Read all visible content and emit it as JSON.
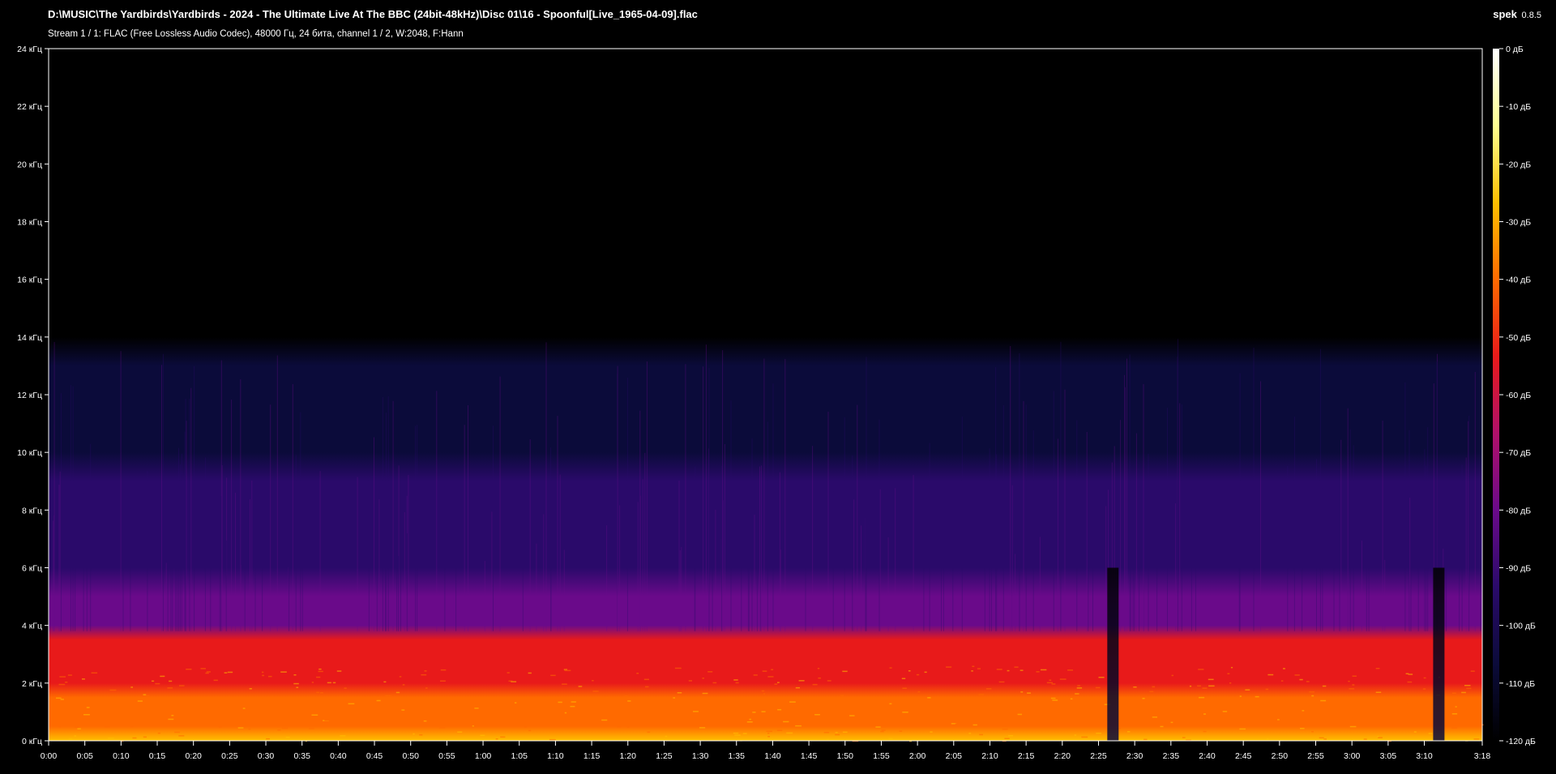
{
  "window": {
    "title": "D:\\MUSIC\\The Yardbirds\\Yardbirds - 2024 - The Ultimate Live At The BBC (24bit-48kHz)\\Disc 01\\16 - Spoonful[Live_1965-04-09].flac",
    "subtitle": "Stream 1 / 1: FLAC (Free Lossless Audio Codec), 48000 Гц, 24 бита, channel 1 / 2, W:2048, F:Hann",
    "app_name": "spek",
    "app_version": "0.8.5"
  },
  "colors": {
    "background": "#000000",
    "axis": "#ffffff",
    "palette": [
      "#000000",
      "#0b0b3a",
      "#2a0a6a",
      "#6a0a8a",
      "#b0106a",
      "#e81a1a",
      "#ff6a00",
      "#ffc000",
      "#ffff90",
      "#ffffff"
    ]
  },
  "chart_data": {
    "type": "heatmap",
    "title": "",
    "xlabel": "",
    "ylabel": "",
    "x_unit": "time (m:ss)",
    "y_unit": "кГц",
    "xlim": [
      0,
      198
    ],
    "ylim": [
      0,
      24
    ],
    "x_ticks": [
      "0:00",
      "0:05",
      "0:10",
      "0:15",
      "0:20",
      "0:25",
      "0:30",
      "0:35",
      "0:40",
      "0:45",
      "0:50",
      "0:55",
      "1:00",
      "1:05",
      "1:10",
      "1:15",
      "1:20",
      "1:25",
      "1:30",
      "1:35",
      "1:40",
      "1:45",
      "1:50",
      "1:55",
      "2:00",
      "2:05",
      "2:10",
      "2:15",
      "2:20",
      "2:25",
      "2:30",
      "2:35",
      "2:40",
      "2:45",
      "2:50",
      "2:55",
      "3:00",
      "3:05",
      "3:10",
      "3:18"
    ],
    "y_ticks": [
      "0 кГц",
      "2 кГц",
      "4 кГц",
      "6 кГц",
      "8 кГц",
      "10 кГц",
      "12 кГц",
      "14 кГц",
      "16 кГц",
      "18 кГц",
      "20 кГц",
      "22 кГц",
      "24 кГц"
    ],
    "colorbar": {
      "range_db": [
        -120,
        0
      ],
      "ticks": [
        "0 дБ",
        "-10 дБ",
        "-20 дБ",
        "-30 дБ",
        "-40 дБ",
        "-50 дБ",
        "-60 дБ",
        "-70 дБ",
        "-80 дБ",
        "-90 дБ",
        "-100 дБ",
        "-110 дБ",
        "-120 дБ"
      ]
    },
    "energy_profile": {
      "freq_khz": [
        0,
        0.5,
        1,
        1.5,
        2,
        2.5,
        3,
        3.5,
        4,
        5,
        6,
        7,
        8,
        9,
        10,
        11,
        12,
        13,
        14,
        15
      ],
      "level_db": [
        -30,
        -35,
        -40,
        -45,
        -48,
        -52,
        -55,
        -60,
        -80,
        -85,
        -88,
        -92,
        -95,
        -98,
        -102,
        -104,
        -107,
        -112,
        -120,
        -120
      ],
      "spectral_cutoff_khz": 14,
      "dropouts_time": [
        "2:27",
        "3:12"
      ]
    }
  }
}
